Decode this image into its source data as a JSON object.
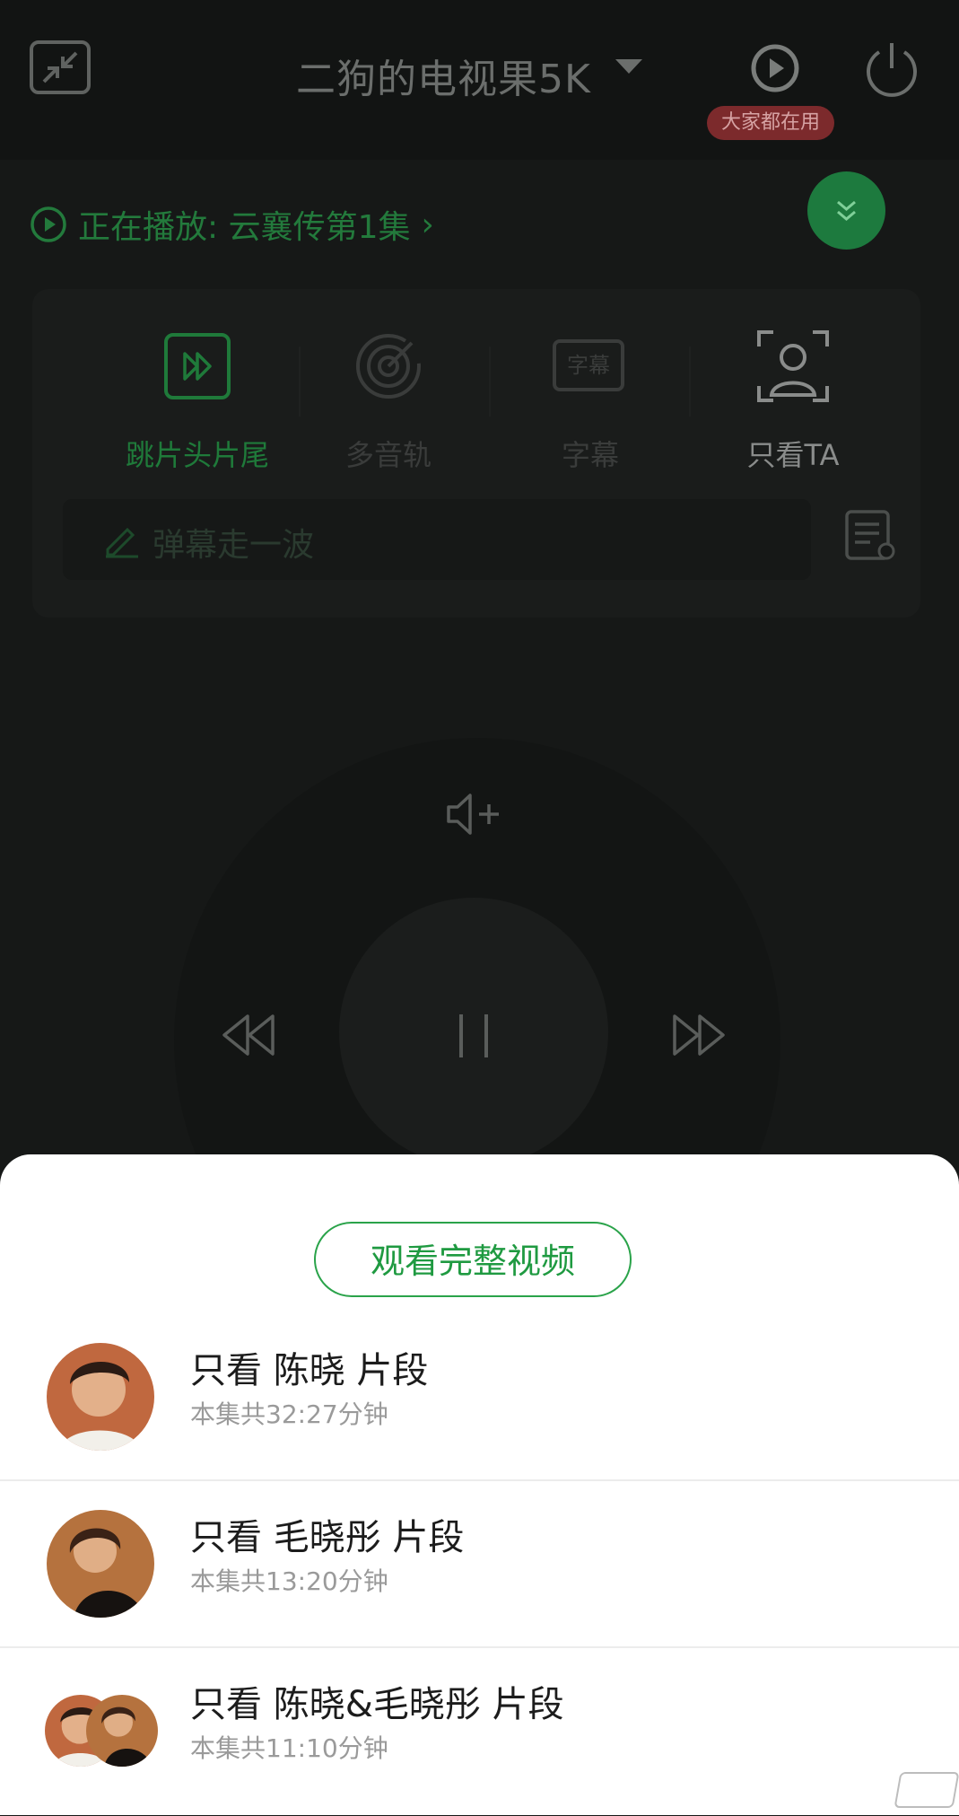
{
  "header": {
    "device_title": "二狗的电视果5K",
    "badge": "大家都在用",
    "icons": [
      "shrink-icon",
      "dropdown-caret-icon",
      "cast-icon",
      "power-icon"
    ]
  },
  "now_playing": {
    "label": "正在播放: 云襄传第1集",
    "chevron": "›"
  },
  "features": [
    {
      "label": "跳片头片尾",
      "icon": "skip-intro-icon",
      "color": "#1f7a3a"
    },
    {
      "label": "多音轨",
      "icon": "audio-track-icon",
      "color": "#3a3c3b"
    },
    {
      "label": "字幕",
      "icon": "subtitle-icon",
      "icon_text": "字幕",
      "color": "#3a3c3b"
    },
    {
      "label": "只看TA",
      "icon": "focus-person-icon",
      "color": "#8a8c8b"
    }
  ],
  "danmu": {
    "placeholder": "弹幕走一波",
    "settings_icon": "danmu-settings-icon"
  },
  "remote": {
    "icons": [
      "volume-up-icon",
      "rewind-icon",
      "pause-icon",
      "fast-forward-icon"
    ]
  },
  "sheet": {
    "full_button": "观看完整视频",
    "options": [
      {
        "title": "只看 陈晓 片段",
        "subtitle": "本集共32:27分钟"
      },
      {
        "title": "只看 毛晓彤 片段",
        "subtitle": "本集共13:20分钟"
      },
      {
        "title": "只看 陈晓&毛晓彤 片段",
        "subtitle": "本集共11:10分钟"
      }
    ]
  },
  "colors": {
    "accent_green": "#1f9a41",
    "badge_red": "#7c2a2c",
    "background": "#161817"
  }
}
